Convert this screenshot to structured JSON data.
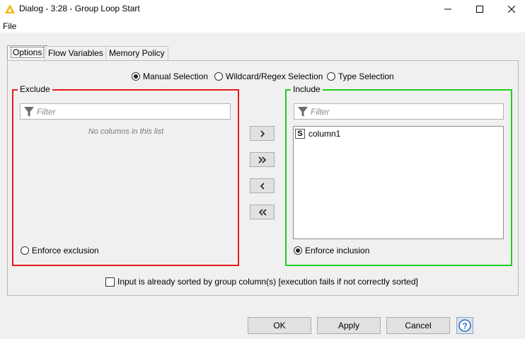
{
  "window": {
    "title": "Dialog - 3:28 - Group Loop Start",
    "icon": "knime-warning-icon"
  },
  "menu": {
    "file": "File"
  },
  "tabs": [
    {
      "label": "Options",
      "active": true
    },
    {
      "label": "Flow Variables",
      "active": false
    },
    {
      "label": "Memory Policy",
      "active": false
    }
  ],
  "selection_modes": {
    "manual": "Manual Selection",
    "wildcard": "Wildcard/Regex Selection",
    "type": "Type Selection",
    "selected": "manual"
  },
  "exclude": {
    "title": "Exclude",
    "filter_placeholder": "Filter",
    "empty_message": "No columns in this list",
    "enforce_label": "Enforce exclusion",
    "enforce_checked": false,
    "color": "#e31a1c"
  },
  "include": {
    "title": "Include",
    "filter_placeholder": "Filter",
    "items": [
      {
        "type": "S",
        "name": "column1"
      }
    ],
    "enforce_label": "Enforce inclusion",
    "enforce_checked": true,
    "color": "#22cc22"
  },
  "move_buttons": [
    "chevron-right-icon",
    "double-chevron-right-icon",
    "chevron-left-icon",
    "double-chevron-left-icon"
  ],
  "sorted_option": {
    "label": "Input is already sorted by group column(s) [execution fails if not correctly sorted]",
    "checked": false
  },
  "buttons": {
    "ok": "OK",
    "apply": "Apply",
    "cancel": "Cancel",
    "help_icon": "help-icon"
  }
}
